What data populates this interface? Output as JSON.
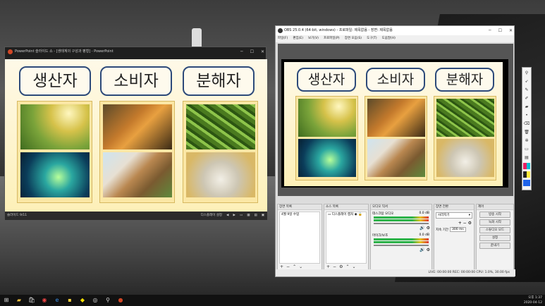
{
  "ppt": {
    "title": "PowerPoint 슬라이드 쇼 - [생태계의 구성과 평형] - PowerPoint",
    "status_left": "슬라이드 9/11",
    "status_display": "디스플레이 설정",
    "win_min": "─",
    "win_max": "☐",
    "win_close": "✕"
  },
  "slide": {
    "headers": [
      "생산자",
      "소비자",
      "분해자"
    ]
  },
  "obs": {
    "title": "OBS 25.0.4 (64-bit, windows) - 프로파일: 제목없음 - 장면: 제목없음",
    "menu": [
      "파일(F)",
      "편집(E)",
      "보기(V)",
      "프로파일(P)",
      "장면 모음(S)",
      "도구(T)",
      "도움말(H)"
    ],
    "scenes_header": "장면 목록",
    "scene_item": "4월 9일 수업",
    "sources_header": "소스 목록",
    "source_item": "디스플레이 캡처",
    "mixer_header": "오디오 믹서",
    "mixer_desktop": "데스크탑 오디오",
    "mixer_desktop_db": "0.0 dB",
    "mixer_mic": "마이크/보조",
    "mixer_mic_db": "0.0 dB",
    "transition_header": "장면 전환",
    "transition_select": "사라지기",
    "duration_label": "지속 기간",
    "duration_value": "300 ms",
    "controls_header": "제어",
    "controls": [
      "방송 시작",
      "녹화 시작",
      "스튜디오 모드",
      "설정",
      "끝내기"
    ],
    "status": "LIVE: 00:00:00     REC: 00:00:00     CPU: 1.0%, 30.00 fps",
    "win_min": "─",
    "win_max": "☐",
    "win_close": "✕"
  },
  "taskbar": {
    "clock_time": "오후 1:37",
    "clock_date": "2020-04-12"
  },
  "colors": {
    "slide_header_border": "#2d4a7a",
    "slide_bg": "#fdf0b8",
    "taskbar": "#111111"
  }
}
